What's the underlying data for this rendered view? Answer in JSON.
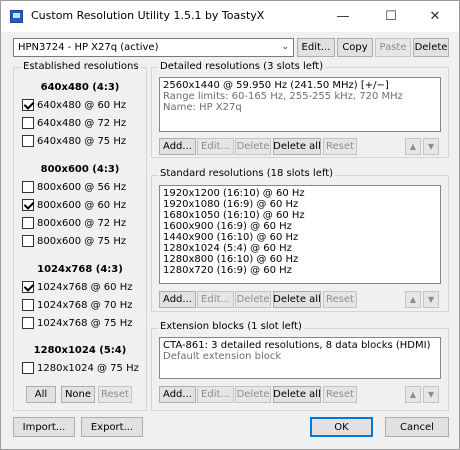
{
  "window": {
    "title": "Custom Resolution Utility 1.5.1 by ToastyX",
    "minimize": "—",
    "maximize": "☐",
    "close": "✕"
  },
  "monitor": {
    "selected": "HPN3724 - HP X27q (active)",
    "edit": "Edit...",
    "copy": "Copy",
    "paste": "Paste",
    "delete": "Delete"
  },
  "established": {
    "title": "Established resolutions",
    "groups": [
      {
        "heading": "640x480 (4:3)",
        "items": [
          {
            "label": "640x480 @ 60 Hz",
            "checked": true
          },
          {
            "label": "640x480 @ 72 Hz",
            "checked": false
          },
          {
            "label": "640x480 @ 75 Hz",
            "checked": false
          }
        ]
      },
      {
        "heading": "800x600 (4:3)",
        "items": [
          {
            "label": "800x600 @ 56 Hz",
            "checked": false
          },
          {
            "label": "800x600 @ 60 Hz",
            "checked": true
          },
          {
            "label": "800x600 @ 72 Hz",
            "checked": false
          },
          {
            "label": "800x600 @ 75 Hz",
            "checked": false
          }
        ]
      },
      {
        "heading": "1024x768 (4:3)",
        "items": [
          {
            "label": "1024x768 @ 60 Hz",
            "checked": true
          },
          {
            "label": "1024x768 @ 70 Hz",
            "checked": false
          },
          {
            "label": "1024x768 @ 75 Hz",
            "checked": false
          }
        ]
      },
      {
        "heading": "1280x1024 (5:4)",
        "items": [
          {
            "label": "1280x1024 @ 75 Hz",
            "checked": false
          }
        ]
      }
    ],
    "all": "All",
    "none": "None",
    "reset": "Reset"
  },
  "detailed": {
    "title": "Detailed resolutions (3 slots left)",
    "lines": [
      "2560x1440 @ 59.950 Hz (241.50 MHz) [+/−]",
      "Range limits: 60-165 Hz, 255-255 kHz, 720 MHz",
      "Name: HP X27q"
    ],
    "add": "Add...",
    "edit": "Edit...",
    "delete": "Delete",
    "delete_all": "Delete all",
    "reset": "Reset",
    "up": "▲",
    "down": "▼"
  },
  "standard": {
    "title": "Standard resolutions (18 slots left)",
    "lines": [
      "1920x1200 (16:10) @ 60 Hz",
      "1920x1080 (16:9) @ 60 Hz",
      "1680x1050 (16:10) @ 60 Hz",
      "1600x900 (16:9) @ 60 Hz",
      "1440x900 (16:10) @ 60 Hz",
      "1280x1024 (5:4) @ 60 Hz",
      "1280x800 (16:10) @ 60 Hz",
      "1280x720 (16:9) @ 60 Hz"
    ],
    "add": "Add...",
    "edit": "Edit...",
    "delete": "Delete",
    "delete_all": "Delete all",
    "reset": "Reset",
    "up": "▲",
    "down": "▼"
  },
  "extension": {
    "title": "Extension blocks (1 slot left)",
    "lines": [
      "CTA-861: 3 detailed resolutions, 8 data blocks (HDMI)",
      "Default extension block"
    ],
    "add": "Add...",
    "edit": "Edit...",
    "delete": "Delete",
    "delete_all": "Delete all",
    "reset": "Reset",
    "up": "▲",
    "down": "▼"
  },
  "footer": {
    "import": "Import...",
    "export": "Export...",
    "ok": "OK",
    "cancel": "Cancel"
  }
}
